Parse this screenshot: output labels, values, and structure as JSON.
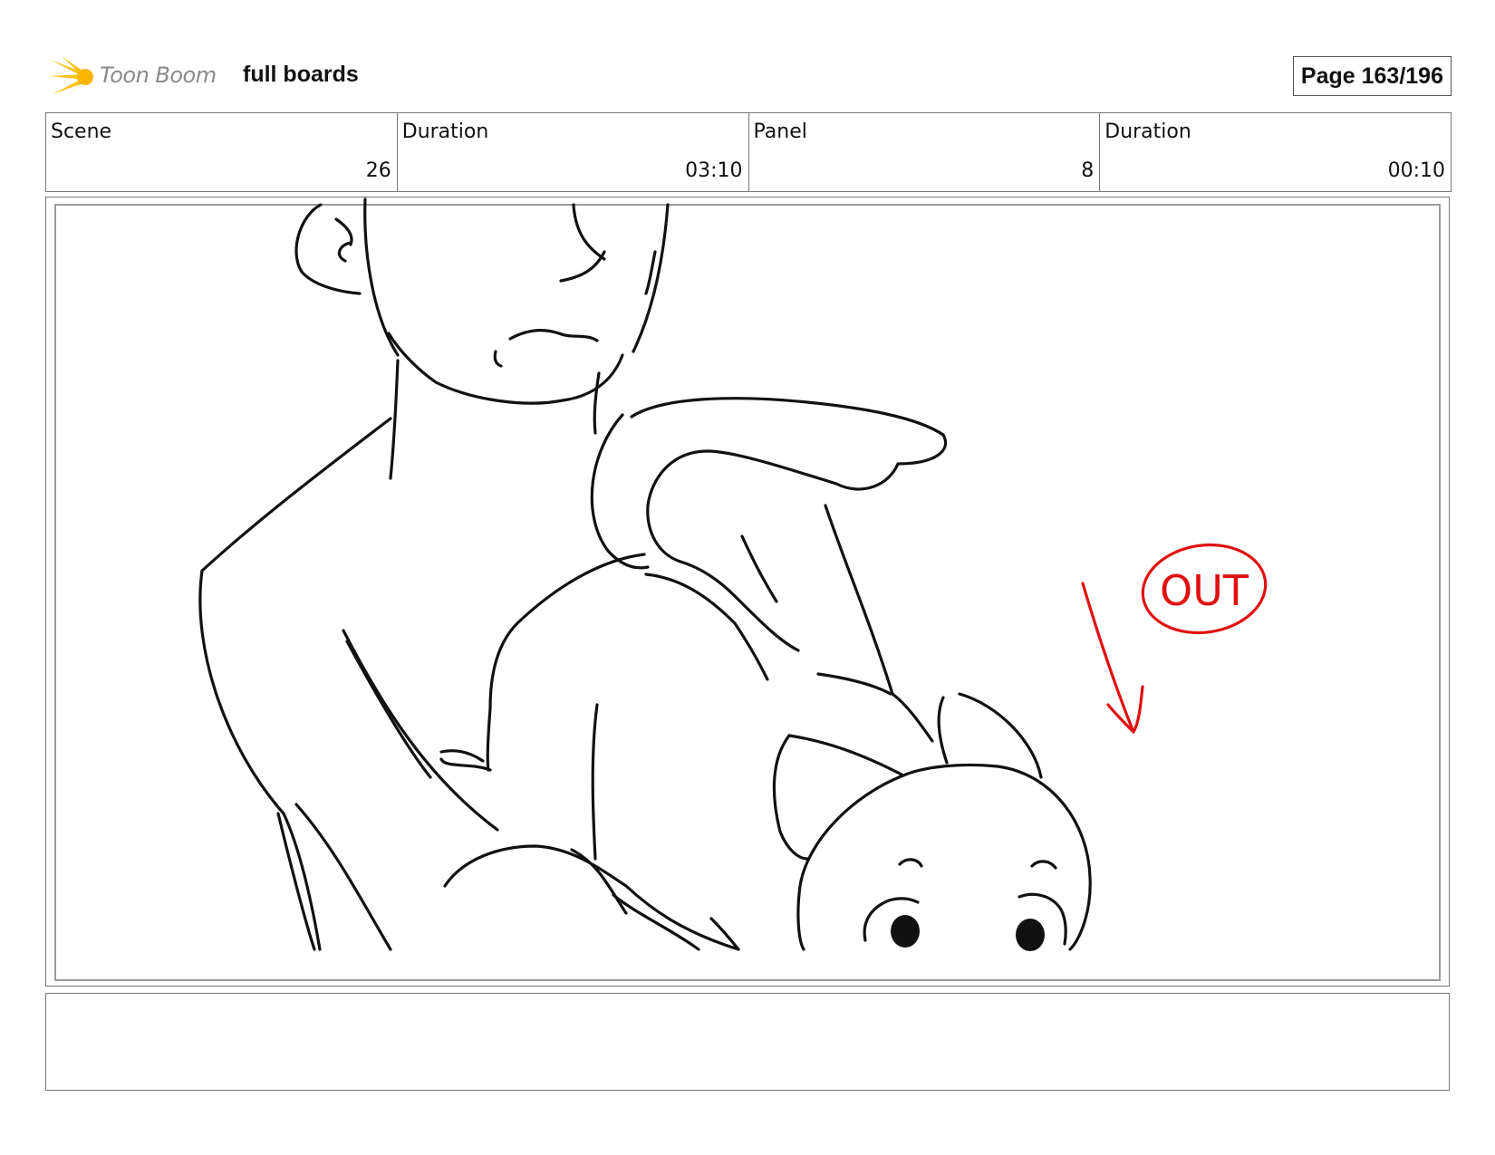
{
  "header": {
    "logo_text": "Toon Boom",
    "title": "full boards",
    "page": "Page 163/196"
  },
  "info": {
    "scene_label": "Scene",
    "scene_value": "26",
    "scene_duration_label": "Duration",
    "scene_duration_value": "03:10",
    "panel_label": "Panel",
    "panel_value": "8",
    "panel_duration_label": "Duration",
    "panel_duration_value": "00:10"
  },
  "panel": {
    "annotation_text": "OUT",
    "annotation_color": "#e01010"
  },
  "notes": {
    "text": ""
  }
}
